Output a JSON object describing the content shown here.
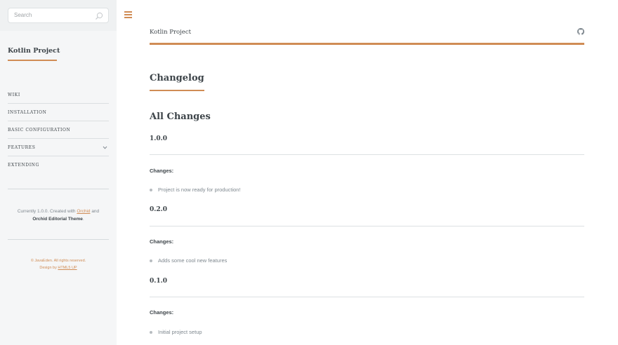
{
  "sidebar": {
    "search": {
      "placeholder": "Search"
    },
    "title": "Kotlin Project",
    "nav": [
      {
        "label": "Wiki"
      },
      {
        "label": "Installation"
      },
      {
        "label": "Basic Configuration"
      },
      {
        "label": "Features",
        "has_submenu": true
      },
      {
        "label": "Extending"
      }
    ],
    "credit": {
      "prefix": "Currently 1.0.0. Created with ",
      "orchid_link": "Orchid",
      "mid": " and",
      "theme": "Orchid Editorial Theme",
      "suffix": "."
    },
    "copyright": {
      "line1": "© JavaEden. All rights reserved.",
      "design_prefix": "Design by ",
      "design_link": "HTML5 UP"
    }
  },
  "header": {
    "title": "Kotlin Project",
    "github_icon": "github-icon"
  },
  "main": {
    "page_title": "Changelog",
    "section_title": "All Changes",
    "versions": [
      {
        "version": "1.0.0",
        "changes_label": "Changes:",
        "items": [
          "Project is now ready for production!"
        ]
      },
      {
        "version": "0.2.0",
        "changes_label": "Changes:",
        "items": [
          "Adds some cool new features"
        ]
      },
      {
        "version": "0.1.0",
        "changes_label": "Changes:",
        "items": [
          "Initial project setup"
        ]
      }
    ]
  },
  "colors": {
    "accent": "#d08c55",
    "heading": "#3d4449",
    "text": "#7f888f",
    "sidebar_bg": "#f5f6f7"
  }
}
